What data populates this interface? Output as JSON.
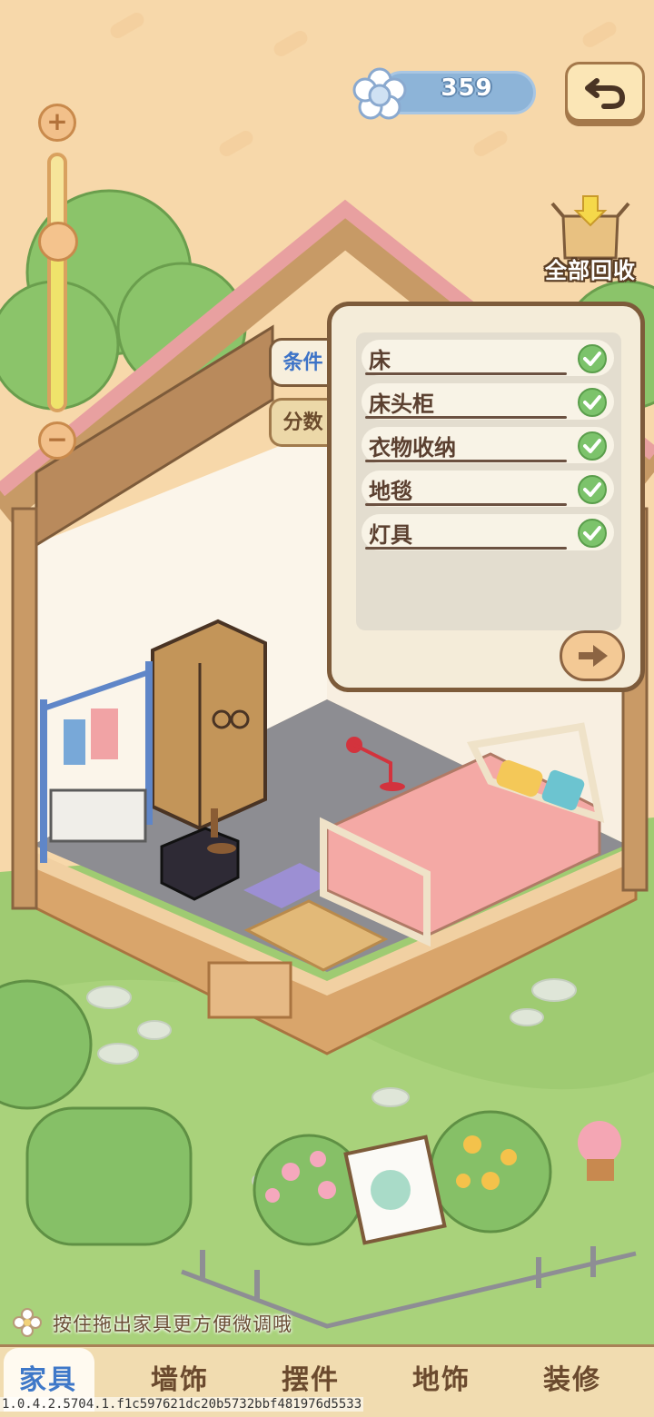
{
  "currency": {
    "icon": "flower-icon",
    "value": "359"
  },
  "back_button": {
    "icon": "undo-arrow-icon"
  },
  "recycle_all": {
    "icon": "cardboard-box-icon",
    "label": "全部回收"
  },
  "zoom": {
    "plus": "+",
    "minus": "−",
    "level": 0.35
  },
  "side_tabs": {
    "conditions": "条件",
    "score": "分数",
    "active": "conditions"
  },
  "requirements": [
    {
      "label": "床",
      "done": true
    },
    {
      "label": "床头柜",
      "done": true
    },
    {
      "label": "衣物收纳",
      "done": true
    },
    {
      "label": "地毯",
      "done": true
    },
    {
      "label": "灯具",
      "done": true
    }
  ],
  "next_button": {
    "icon": "arrow-right-icon"
  },
  "hint": {
    "icon": "flower-sparkle-icon",
    "text": "按住拖出家具更方便微调哦"
  },
  "bottom_nav": {
    "items": [
      "家具",
      "墙饰",
      "摆件",
      "地饰",
      "装修"
    ],
    "active": "家具"
  },
  "version": "1.0.4.2.5704.1.f1c597621dc20b5732bbf481976d5533",
  "colors": {
    "accent_blue": "#3f78c8",
    "check_green": "#7cc36b",
    "panel_border": "#7d5b3a"
  }
}
